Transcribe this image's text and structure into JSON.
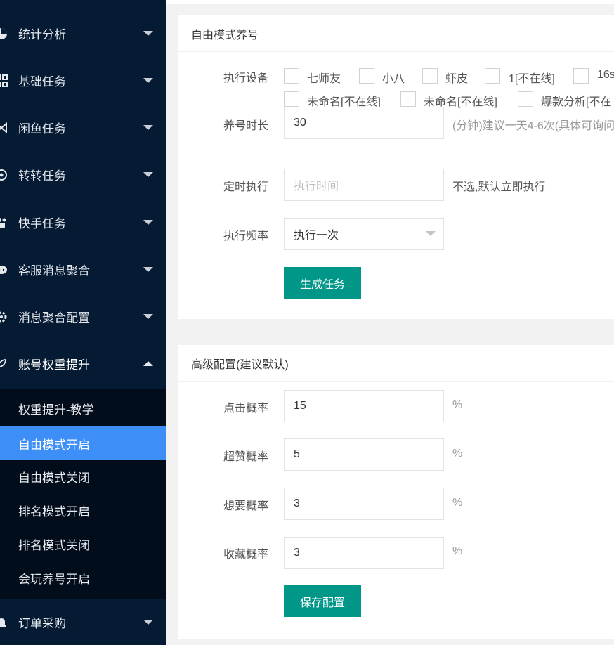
{
  "sidebar": {
    "items": [
      {
        "label": "统计分析",
        "icon": "pie-chart-icon"
      },
      {
        "label": "基础任务",
        "icon": "grid-icon"
      },
      {
        "label": "闲鱼任务",
        "icon": "fish-icon"
      },
      {
        "label": "转转任务",
        "icon": "refresh-icon"
      },
      {
        "label": "快手任务",
        "icon": "camera-icon"
      },
      {
        "label": "客服消息聚合",
        "icon": "chat-icon"
      },
      {
        "label": "消息聚合配置",
        "icon": "settings-icon"
      },
      {
        "label": "账号权重提升",
        "icon": "rocket-icon"
      },
      {
        "label": "订单采购",
        "icon": "bell-icon"
      }
    ],
    "submenu": [
      {
        "label": "权重提升-教学"
      },
      {
        "label": "自由模式开启",
        "active": true
      },
      {
        "label": "自由模式关闭"
      },
      {
        "label": "排名模式开启"
      },
      {
        "label": "排名模式关闭"
      },
      {
        "label": "会玩养号开启"
      }
    ],
    "active_color": "#3d8ff7",
    "bg_color": "#051a33"
  },
  "panel1": {
    "title": "自由模式养号",
    "device_label": "执行设备",
    "devices_row1": [
      "七师友",
      "小八",
      "虾皮",
      "1[不在线]",
      "16s"
    ],
    "devices_row2": [
      "未命名[不在线]",
      "未命名[不在线]",
      "爆款分析[不在"
    ],
    "duration_label": "养号时长",
    "duration_value": "30",
    "duration_hint": "(分钟)建议一天4-6次(具体可询问",
    "schedule_label": "定时执行",
    "schedule_placeholder": "执行时间",
    "schedule_hint": "不选,默认立即执行",
    "frequency_label": "执行频率",
    "frequency_value": "执行一次",
    "generate_button": "生成任务"
  },
  "panel2": {
    "title": "高级配置(建议默认)",
    "click_label": "点击概率",
    "click_value": "15",
    "like_label": "超赞概率",
    "like_value": "5",
    "want_label": "想要概率",
    "want_value": "3",
    "fav_label": "收藏概率",
    "fav_value": "3",
    "percent": "%",
    "save_button": "保存配置"
  },
  "button_color": "#009688"
}
